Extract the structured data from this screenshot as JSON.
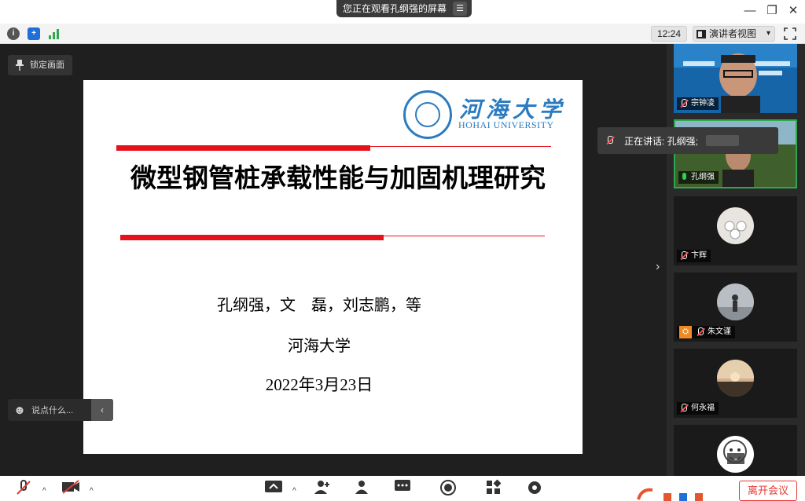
{
  "titlebar": {
    "share_notice": "您正在观看孔纲强的屏幕",
    "menu_icon": "list-icon"
  },
  "toolbar": {
    "time": "12:24",
    "view_mode": "演讲者视图",
    "view_caret": "▾"
  },
  "stage": {
    "lock_label": "锁定画面",
    "chat_placeholder": "说点什么..."
  },
  "slide": {
    "logo_cn": "河海大学",
    "logo_en": "HOHAI UNIVERSITY",
    "title": "微型钢管桩承载性能与加固机理研究",
    "authors": "孔纲强，文　磊，刘志鹏，等",
    "institution": "河海大学",
    "date": "2022年3月23日"
  },
  "speaking": {
    "label": "正在讲话: 孔纲强;"
  },
  "participants": [
    {
      "name": "宗钟凌",
      "mic": "off"
    },
    {
      "name": "孔纲强",
      "mic": "on"
    },
    {
      "name": "卞辉",
      "mic": "off"
    },
    {
      "name": "朱文谨",
      "mic": "off",
      "host": true
    },
    {
      "name": "何永福",
      "mic": "off"
    },
    {
      "name": "",
      "mic": "off"
    }
  ],
  "bottom": {
    "leave_label": "离开会议"
  },
  "colors": {
    "accent_red": "#e6111b",
    "hohai_blue": "#2b7bc0",
    "speaking_green": "#2fa84f",
    "leave_red": "#e53935"
  }
}
